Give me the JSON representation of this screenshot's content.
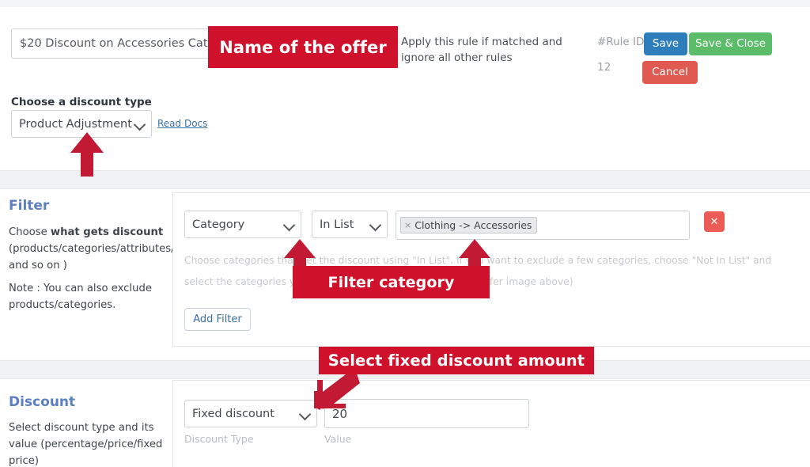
{
  "header": {
    "offer_name_value": "$20 Discount on Accessories Category",
    "offer_name_placeholder": "Name of the offer",
    "apply_note": "Apply this rule if matched and ignore all other rules",
    "rule_id_label": "#Rule ID:",
    "rule_id_value": "12",
    "save_label": "Save",
    "save_close_label": "Save & Close",
    "cancel_label": "Cancel"
  },
  "discount_type": {
    "label": "Choose a discount type",
    "selected": "Product Adjustment",
    "read_docs_label": "Read Docs"
  },
  "filter": {
    "title": "Filter",
    "desc_line_1": "Choose what gets discount (products/categories/attributes/SKU and so on )",
    "desc_strong": "what gets discount",
    "desc_prefix": "Choose ",
    "desc_suffix": " (products/categories/attributes/SKU and so on )",
    "note": "Note : You can also exclude products/categories.",
    "attribute_selected": "Category",
    "operator_selected": "In List",
    "tag_remove_glyph": "×",
    "tag_label": "Clothing -> Accessories",
    "remove_filter_glyph": "✕",
    "help_text": "Choose categories that get the discount using \"In List\". If you want to exclude a few categories, choose \"Not In List\" and select the categories you wanted to exclude from discount (Refer image above)",
    "add_filter_label": "Add Filter"
  },
  "discount": {
    "title": "Discount",
    "desc": "Select discount type and its value (percentage/price/fixed price)",
    "type_selected": "Fixed discount",
    "value": "20",
    "type_sub_label": "Discount Type",
    "value_sub_label": "Value"
  },
  "annotations": {
    "offer_name": "Name of the offer",
    "filter_category": "Filter category",
    "fixed_discount": "Select fixed discount amount"
  },
  "colors": {
    "annotation_red": "#D0112B",
    "save_blue": "#2E7EBB",
    "save_close_green": "#5BBC6A",
    "cancel_red": "#E05A51",
    "section_title_blue": "#5B7FC0"
  }
}
